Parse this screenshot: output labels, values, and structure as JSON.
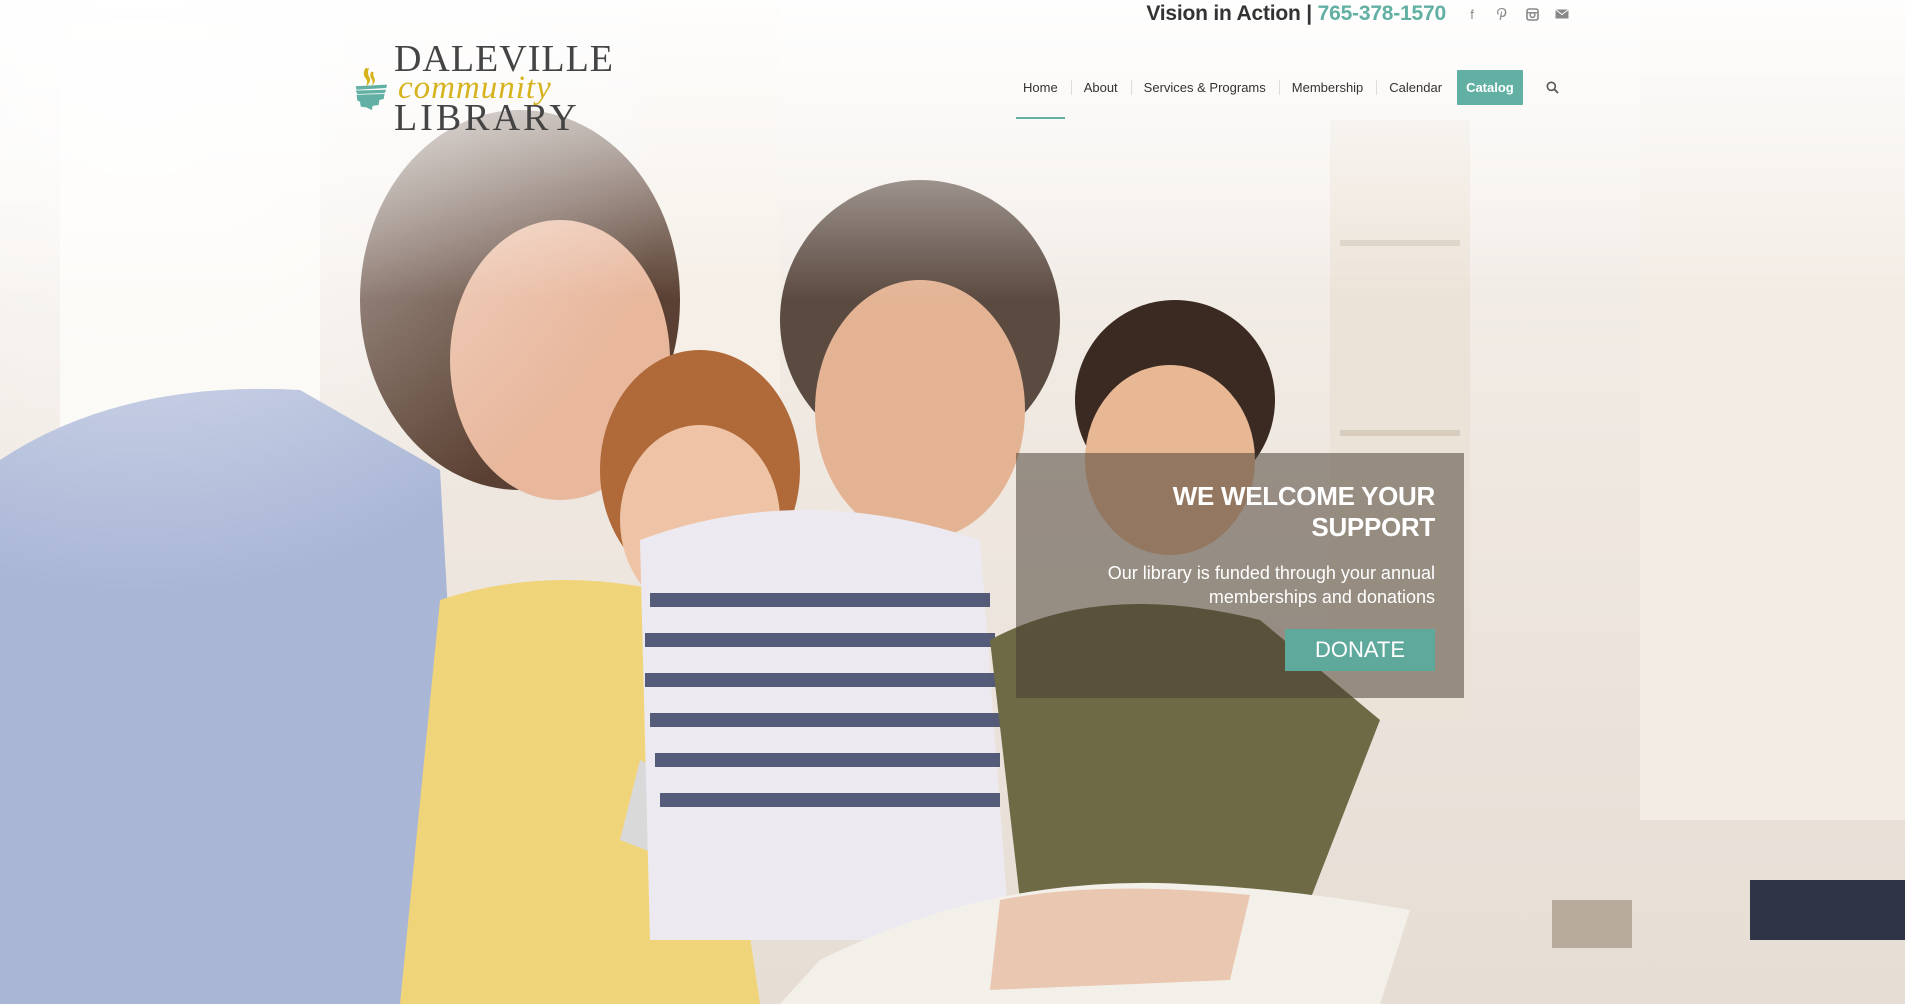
{
  "header": {
    "slogan": "Vision in Action |",
    "phone": "765-378-1570",
    "social_icons": [
      "facebook-icon",
      "pinterest-icon",
      "instagram-icon",
      "mail-icon"
    ]
  },
  "logo": {
    "line1": "DALEVILLE",
    "line2": "community",
    "line3": "LIBRARY"
  },
  "nav": {
    "items": [
      {
        "label": "Home",
        "active": true
      },
      {
        "label": "About"
      },
      {
        "label": "Services & Programs"
      },
      {
        "label": "Membership"
      },
      {
        "label": "Calendar"
      },
      {
        "label": "Catalog",
        "highlight": true
      }
    ],
    "search_icon": "search-icon"
  },
  "hero": {
    "heading": "WE WELCOME YOUR SUPPORT",
    "body": "Our library is funded through your annual memberships and donations",
    "button": "DONATE"
  },
  "colors": {
    "accent": "#62b0a3",
    "logo_gold": "#d6b21c",
    "text_dark": "#333333"
  }
}
